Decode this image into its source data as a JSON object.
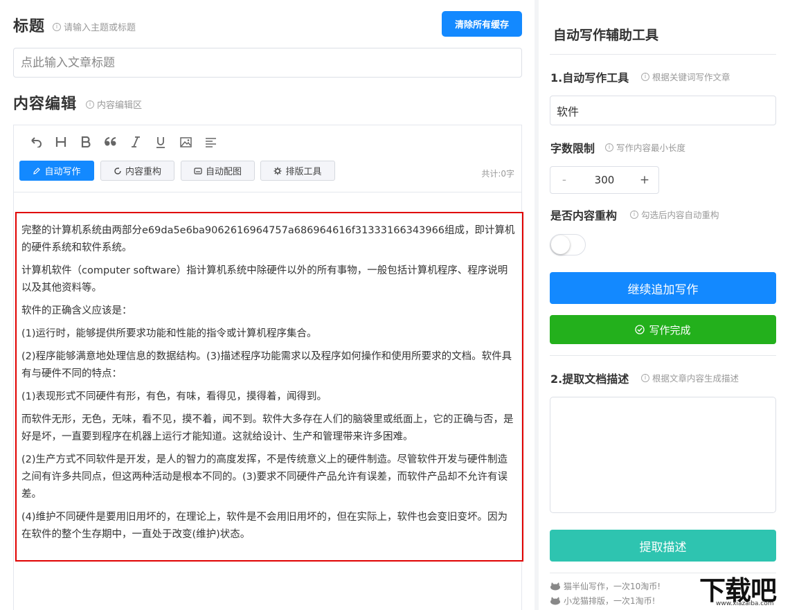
{
  "left": {
    "title_section": {
      "label": "标题",
      "hint": "请输入主题或标题"
    },
    "clear_cache_label": "清除所有缓存",
    "title_input_placeholder": "点此输入文章标题",
    "content_section": {
      "label": "内容编辑",
      "hint": "内容编辑区"
    },
    "toolbar": {
      "icons": [
        "undo-icon",
        "heading-icon",
        "bold-icon",
        "quote-icon",
        "italic-icon",
        "underline-icon",
        "image-icon",
        "align-left-icon"
      ],
      "buttons": [
        {
          "label": "自动写作",
          "icon": "pencil-icon",
          "active": true
        },
        {
          "label": "内容重构",
          "icon": "refresh-icon",
          "active": false
        },
        {
          "label": "自动配图",
          "icon": "picture-icon",
          "active": false
        },
        {
          "label": "排版工具",
          "icon": "settings-icon",
          "active": false
        }
      ],
      "count": "共计:0字"
    },
    "paragraphs": [
      "完整的计算机系统由两部分e69da5e6ba9062616964757a686964616f31333166343966组成，即计算机的硬件系统和软件系统。",
      "计算机软件（computer software）指计算机系统中除硬件以外的所有事物，一般包括计算机程序、程序说明以及其他资料等。",
      "软件的正确含义应该是：",
      "(1)运行时，能够提供所要求功能和性能的指令或计算机程序集合。",
      "(2)程序能够满意地处理信息的数据结构。(3)描述程序功能需求以及程序如何操作和使用所要求的文档。软件具有与硬件不同的特点：",
      "(1)表现形式不同硬件有形，有色，有味，看得见，摸得着，闻得到。",
      "而软件无形，无色，无味，看不见，摸不着，闻不到。软件大多存在人们的脑袋里或纸面上，它的正确与否，是好是坏，一直要到程序在机器上运行才能知道。这就给设计、生产和管理带来许多困难。",
      "(2)生产方式不同软件是开发，是人的智力的高度发挥，不是传统意义上的硬件制造。尽管软件开发与硬件制造之间有许多共同点，但这两种活动是根本不同的。(3)要求不同硬件产品允许有误差，而软件产品却不允许有误差。",
      "(4)维护不同硬件是要用旧用坏的，在理论上，软件是不会用旧用坏的，但在实际上，软件也会变旧变坏。因为在软件的整个生存期中，一直处于改变(维护)状态。"
    ]
  },
  "right": {
    "title": "自动写作辅助工具",
    "auto_write": {
      "label": "1.自动写作工具",
      "hint": "根据关键词写作文章",
      "keyword": "软件"
    },
    "word_limit": {
      "label": "字数限制",
      "hint": "写作内容最小长度",
      "minus": "-",
      "value": "300",
      "plus": "+"
    },
    "restructure": {
      "label": "是否内容重构",
      "hint": "勾选后内容自动重构",
      "enabled": false
    },
    "continue_label": "继续追加写作",
    "done_label": "写作完成",
    "extract": {
      "label": "2.提取文档描述",
      "hint": "根据文章内容生成描述",
      "button": "提取描述"
    },
    "footer": [
      "猫半仙写作，一次10淘币!",
      "小龙猫排版，一次1淘币!"
    ]
  },
  "watermark": {
    "text": "下载吧",
    "url": "www.xiazaiba.com"
  },
  "colors": {
    "primary": "#1389ff",
    "success": "#23b01c",
    "teal": "#2ec4b0",
    "highlight": "#e00000"
  }
}
